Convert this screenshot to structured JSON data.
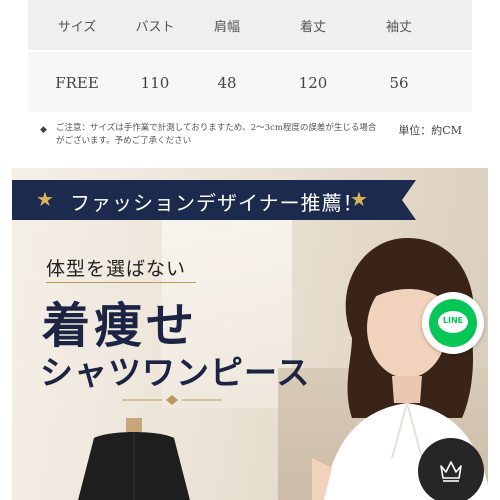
{
  "size_table": {
    "headers": [
      "サイズ",
      "バスト",
      "肩幅",
      "着丈",
      "袖丈"
    ],
    "values": [
      "FREE",
      "110",
      "48",
      "120",
      "56"
    ]
  },
  "note": {
    "diamond": "◆",
    "text": "ご注意：サイズは手作業で計測しておりますため、2～3cm程度の誤差が生じる場合がございます。予めご了承ください",
    "unit": "単位：約CM"
  },
  "banner": {
    "ribbon_text": "ファッションデザイナー推薦！",
    "subhead": "体型を選ばない",
    "headline": "着痩せ",
    "headline2": "シャツワンピース",
    "colors": {
      "ribbon": "#1c2a4d",
      "star": "#d6b35c",
      "headline": "#1b2443"
    }
  },
  "floating": {
    "line_label": "LINE",
    "line_color": "#06c755",
    "crown_icon": "crown-icon"
  }
}
